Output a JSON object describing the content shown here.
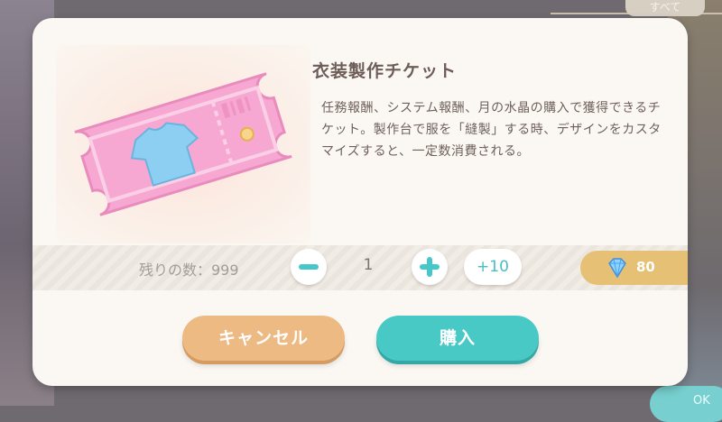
{
  "background": {
    "tab_label": "すべて",
    "ok_label": "OK"
  },
  "dialog": {
    "title": "衣装製作チケット",
    "description": "任務報酬、システム報酬、月の水晶の購入で獲得できるチケット。製作台で服を「縫製」する時、デザインをカスタマイズすると、一定数消費される。",
    "item_icon": "pink-clothing-ticket"
  },
  "quantity": {
    "stock_label": "残りの数：999",
    "value": "1",
    "minus_icon": "minus-icon",
    "plus_icon": "plus-icon",
    "plus10_label": "+10"
  },
  "price": {
    "currency_icon": "blue-crystal-icon",
    "amount": "80"
  },
  "buttons": {
    "cancel_label": "キャンセル",
    "buy_label": "購入"
  },
  "colors": {
    "accent_teal": "#49c9c6",
    "cancel_orange": "#edba83",
    "price_gold": "#e6c074",
    "ticket_pink": "#f6a8d2"
  }
}
